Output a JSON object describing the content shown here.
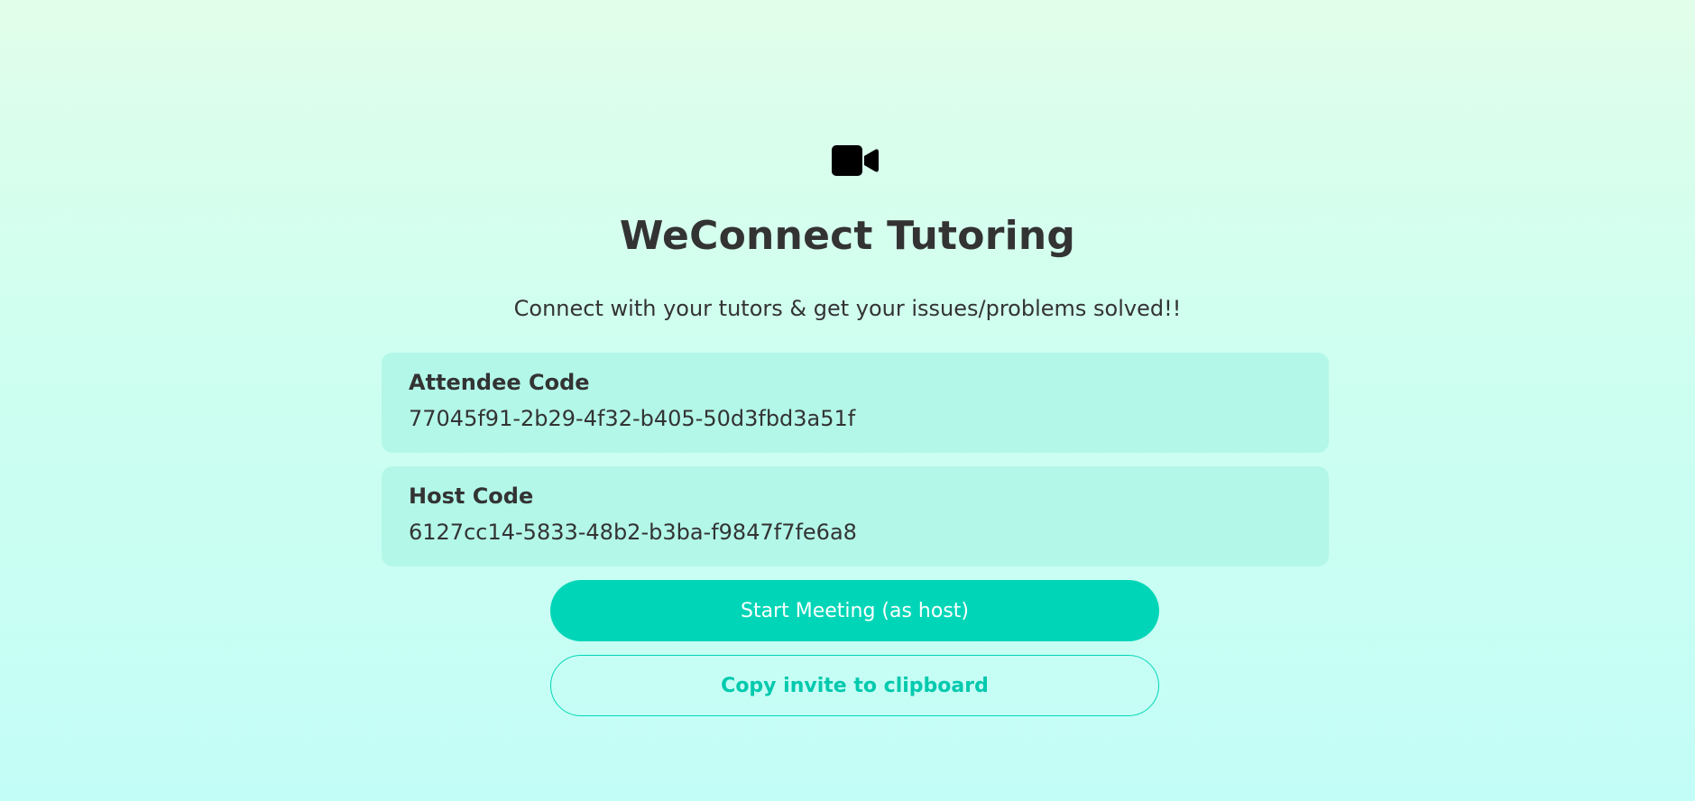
{
  "header": {
    "icon": "video-camera-icon",
    "title": "WeConnect Tutoring",
    "subtitle": "Connect with your tutors & get your issues/problems solved!!"
  },
  "codes": {
    "attendee": {
      "label": "Attendee Code",
      "value": "77045f91-2b29-4f32-b405-50d3fbd3a51f"
    },
    "host": {
      "label": "Host Code",
      "value": "6127cc14-5833-48b2-b3ba-f9847f7fe6a8"
    }
  },
  "actions": {
    "start_label": "Start Meeting (as host)",
    "copy_label": "Copy invite to clipboard"
  },
  "colors": {
    "accent": "#00d6b7",
    "card_background": "#b3f7e8",
    "text": "#333333"
  }
}
